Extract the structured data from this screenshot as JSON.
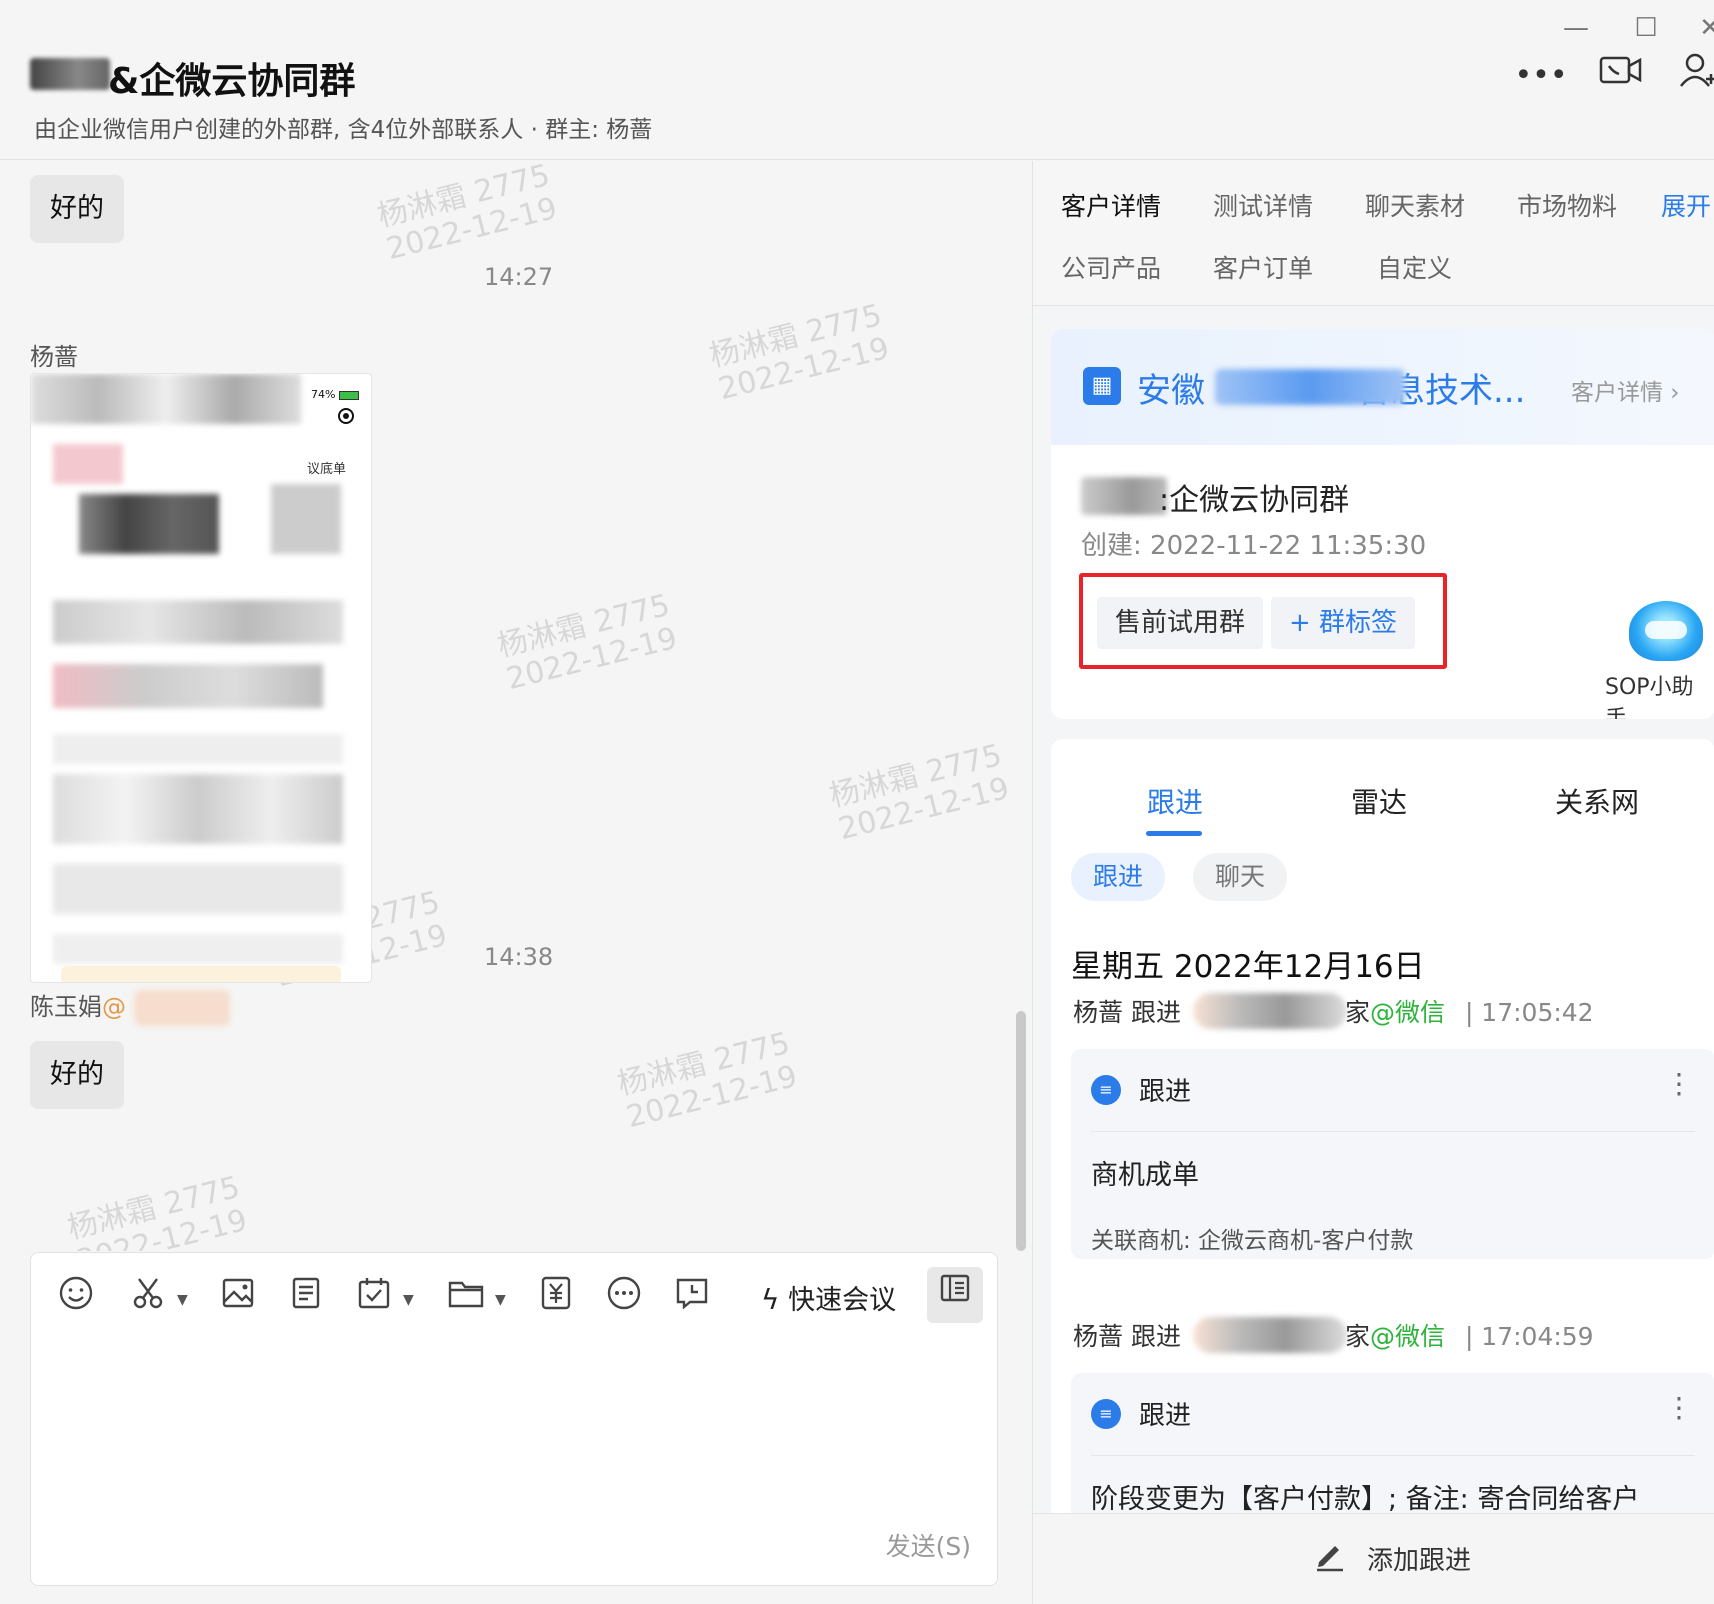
{
  "window": {
    "minimize": "—",
    "maximize": "☐",
    "close": "✕"
  },
  "header": {
    "title": "&企微云协同群",
    "subtitle": "由企业微信用户创建的外部群, 含4位外部联系人 · 群主: 杨蔷",
    "more_icon": "more-icon",
    "video_icon": "video-call-icon",
    "add_member_icon": "add-member-icon"
  },
  "chat": {
    "watermark": {
      "name": "杨淋霜 2775",
      "date": "2022-12-19"
    },
    "messages": [
      {
        "type": "text",
        "text": "好的"
      },
      {
        "type": "time",
        "text": "14:27"
      },
      {
        "type": "sender",
        "text": "杨蔷"
      },
      {
        "type": "image",
        "battery": "74%",
        "fragment": "议底单"
      },
      {
        "type": "time",
        "text": "14:38"
      },
      {
        "type": "sender",
        "text": "陈玉娟",
        "mention": "@"
      },
      {
        "type": "text",
        "text": "好的"
      }
    ]
  },
  "composer": {
    "tools": [
      "emoji-icon",
      "scissors-icon",
      "image-icon",
      "document-icon",
      "calendar-check-icon",
      "folder-icon",
      "payment-icon",
      "more-circle-icon",
      "comment-icon"
    ],
    "quick_meeting": "快速会议",
    "send": "发送(S)"
  },
  "right_panel": {
    "tabs_row1": [
      "客户详情",
      "测试详情",
      "聊天素材",
      "市场物料"
    ],
    "expand": "展开",
    "tabs_row2": [
      "公司产品",
      "客户订单",
      "自定义"
    ],
    "customer": {
      "company_prefix": "安徽",
      "company_suffix": "言息技术...",
      "detail_link": "客户详情 ›",
      "group_name": ":企微云协同群",
      "created_label": "创建: ",
      "created_value": "2022-11-22 11:35:30",
      "tags": [
        "售前试用群"
      ],
      "add_tag": "+ 群标签",
      "sop_label": "SOP小助手"
    },
    "follow": {
      "tabs": [
        "跟进",
        "雷达",
        "关系网"
      ],
      "pills": [
        "跟进",
        "聊天"
      ],
      "date": "星期五 2022年12月16日",
      "records": [
        {
          "user": "杨蔷 跟进",
          "channel_tail": "家",
          "channel": "@微信",
          "time": "| 17:05:42",
          "type": "跟进",
          "title": "商机成单",
          "sub": "关联商机: 企微云商机-客户付款"
        },
        {
          "user": "杨蔷 跟进",
          "channel_tail": "家",
          "channel": "@微信",
          "time": "| 17:04:59",
          "type": "跟进",
          "title": "阶段变更为【客户付款】; 备注: 寄合同给客户"
        }
      ]
    },
    "add_follow": "添加跟进"
  }
}
